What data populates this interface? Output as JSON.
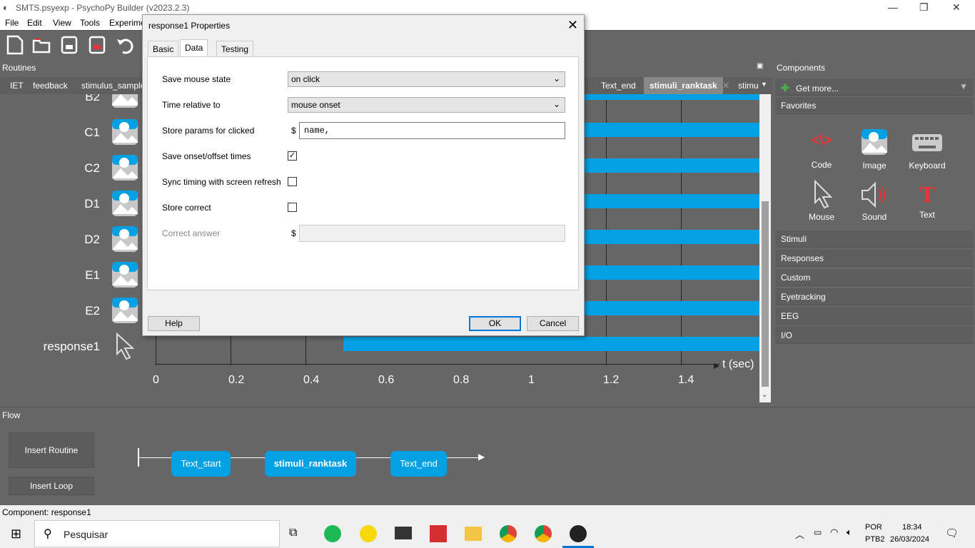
{
  "window": {
    "title": "SMTS.psyexp - PsychoPy Builder (v2023.2.3)"
  },
  "menu": [
    "File",
    "Edit",
    "View",
    "Tools",
    "Experime"
  ],
  "routines": {
    "header": "Routines",
    "tabs": [
      "IET",
      "feedback",
      "stimulus_sample",
      "Text_end",
      "stimuli_ranktask",
      "stimu"
    ],
    "active_tab": "stimuli_ranktask",
    "rows": [
      "B2",
      "C1",
      "C2",
      "D1",
      "D2",
      "E1",
      "E2",
      "response1"
    ],
    "axis_ticks": [
      "0",
      "0.2",
      "0.4",
      "0.6",
      "0.8",
      "1",
      "1.2",
      "1.4"
    ],
    "axis_label": "t (sec)"
  },
  "components": {
    "header": "Components",
    "get_more": "Get more...",
    "favorites_label": "Favorites",
    "favorites": [
      "Code",
      "Image",
      "Keyboard",
      "Mouse",
      "Sound",
      "Text"
    ],
    "categories": [
      "Stimuli",
      "Responses",
      "Custom",
      "Eyetracking",
      "EEG",
      "I/O"
    ]
  },
  "flow": {
    "header": "Flow",
    "insert_routine": "Insert Routine",
    "insert_loop": "Insert Loop",
    "routines": [
      "Text_start",
      "stimuli_ranktask",
      "Text_end"
    ]
  },
  "status": "Component: response1",
  "taskbar": {
    "search": "Pesquisar",
    "lang1": "POR",
    "lang2": "PTB2",
    "time": "18:34",
    "date": "26/03/2024"
  },
  "dialog": {
    "title": "response1 Properties",
    "tabs": [
      "Basic",
      "Data",
      "Testing"
    ],
    "active_tab": "Data",
    "fields": {
      "save_mouse_state": {
        "label": "Save mouse state",
        "value": "on click"
      },
      "time_relative": {
        "label": "Time relative to",
        "value": "mouse onset"
      },
      "store_params": {
        "label": "Store params for clicked",
        "value": "name,"
      },
      "save_onset": {
        "label": "Save onset/offset times",
        "checked": true
      },
      "sync_timing": {
        "label": "Sync timing with screen refresh",
        "checked": false
      },
      "store_correct": {
        "label": "Store correct",
        "checked": false
      },
      "correct_answer": {
        "label": "Correct answer",
        "value": ""
      }
    },
    "dollar": "$",
    "help": "Help",
    "ok": "OK",
    "cancel": "Cancel"
  },
  "colors": {
    "bar": "#03a0e4",
    "panel": "#666666"
  }
}
